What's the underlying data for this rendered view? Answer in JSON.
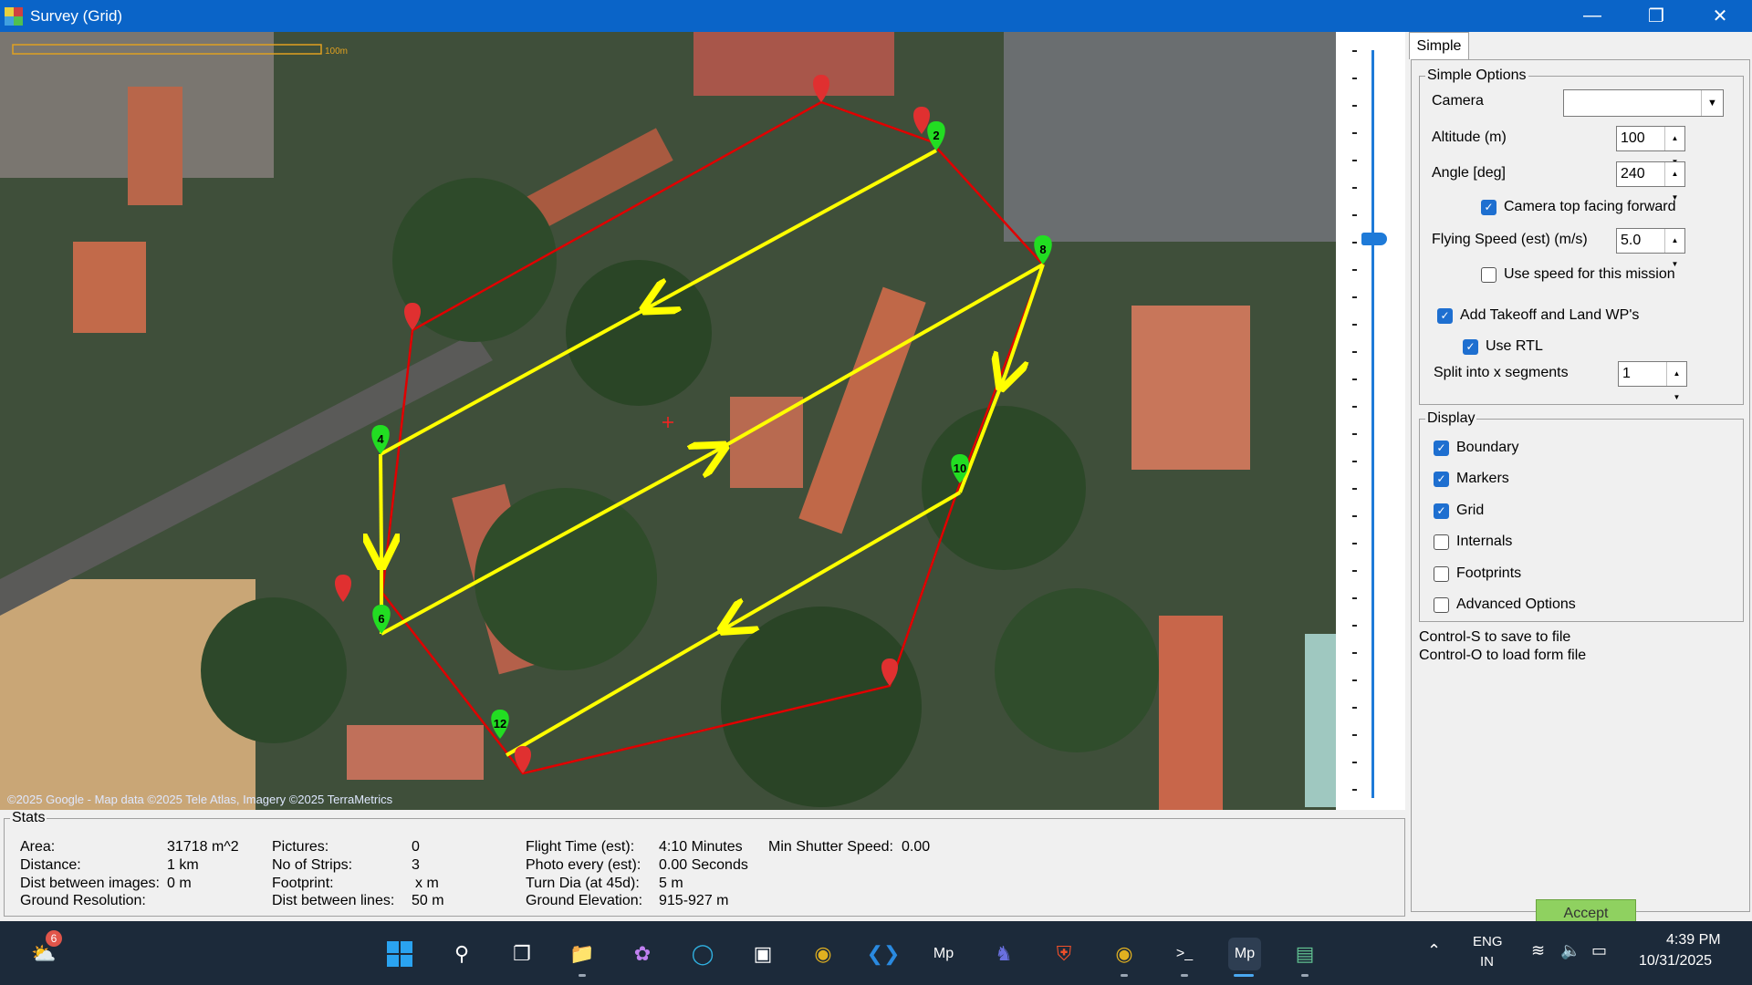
{
  "window": {
    "title": "Survey (Grid)"
  },
  "map": {
    "scale_label": "100m",
    "attribution": "©2025 Google - Map data ©2025 Tele Atlas, Imagery ©2025 TerraMetrics",
    "markers": [
      "2",
      "4",
      "6",
      "8",
      "10",
      "12"
    ]
  },
  "panel": {
    "tab": "Simple",
    "simple_options": {
      "legend": "Simple Options",
      "camera_label": "Camera",
      "camera_value": "",
      "altitude_label": "Altitude (m)",
      "altitude_value": "100",
      "angle_label": "Angle [deg]",
      "angle_value": "240",
      "camera_top_label": "Camera top facing forward",
      "speed_label": "Flying Speed (est) (m/s)",
      "speed_value": "5.0",
      "use_speed_label": "Use speed for this mission",
      "takeoff_label": "Add Takeoff and Land WP's",
      "rtl_label": "Use RTL",
      "split_label": "Split into x segments",
      "split_value": "1"
    },
    "display": {
      "legend": "Display",
      "boundary": "Boundary",
      "markers": "Markers",
      "grid": "Grid",
      "internals": "Internals",
      "footprints": "Footprints",
      "advanced": "Advanced Options"
    },
    "hint1": "Control-S to save to file",
    "hint2": "Control-O to load form file",
    "accept": "Accept"
  },
  "stats": {
    "legend": "Stats",
    "area_label": "Area:",
    "area_value": "31718 m^2",
    "distance_label": "Distance:",
    "distance_value": "1 km",
    "dist_images_label": "Dist between images:",
    "dist_images_value": "0 m",
    "ground_res_label": "Ground Resolution:",
    "pictures_label": "Pictures:",
    "pictures_value": "0",
    "strips_label": "No of Strips:",
    "strips_value": "3",
    "footprint_label": "Footprint:",
    "footprint_value": "x  m",
    "dist_lines_label": "Dist between lines:",
    "dist_lines_value": "50 m",
    "flight_time_label": "Flight Time (est):",
    "flight_time_value": "4:10 Minutes",
    "photo_every_label": "Photo every (est):",
    "photo_every_value": "0.00 Seconds",
    "turn_dia_label": "Turn Dia (at 45d):",
    "turn_dia_value": "5 m",
    "ground_elev_label": "Ground Elevation:",
    "ground_elev_value": "915-927 m",
    "shutter_label": "Min Shutter Speed:",
    "shutter_value": "0.00"
  },
  "taskbar": {
    "badge_count": "6",
    "lang1": "ENG",
    "lang2": "IN",
    "time": "4:39 PM",
    "date": "10/31/2025"
  },
  "colors": {
    "boundary": "#e00000",
    "grid": "#ffff00",
    "marker_green": "#22dd22",
    "marker_red": "#e03030"
  }
}
